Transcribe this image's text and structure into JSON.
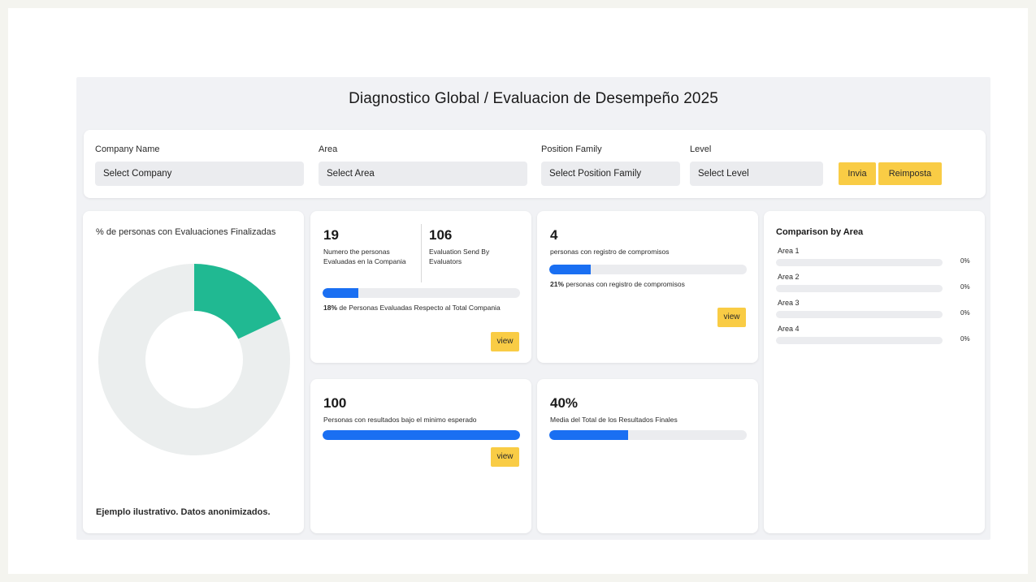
{
  "header": {
    "title": "Diagnostico Global / Evaluacion de Desempeño 2025"
  },
  "filters": {
    "company": {
      "label": "Company Name",
      "value": "Select Company"
    },
    "area": {
      "label": "Area",
      "value": "Select Area"
    },
    "position_family": {
      "label": "Position Family",
      "value": "Select Position Family"
    },
    "level": {
      "label": "Level",
      "value": "Select Level"
    },
    "submit_label": "Invia",
    "reset_label": "Reimposta",
    "accent_color": "#f9cc45"
  },
  "donut": {
    "title": "% de personas con Evaluaciones Finalizadas",
    "completed_fraction": 0.18,
    "completed_color": "#20b992",
    "remaining_color": "#ebeeee",
    "footer": "Ejemplo ilustrativo. Datos anonimizados."
  },
  "card_evaluated": {
    "count": "19",
    "count_label": "Numero the personas Evaluadas en la Compania",
    "sent": "106",
    "sent_label": "Evaluation Send By Evaluators",
    "progress": 0.18,
    "pct": "18%",
    "pct_text": " de Personas Evaluadas Respecto al Total Compania",
    "view_label": "view"
  },
  "card_commitments": {
    "count": "4",
    "count_label": "personas con registro de compromisos",
    "progress": 0.21,
    "pct": "21%",
    "pct_text": " personas con registro de compromisos",
    "view_label": "view"
  },
  "card_below": {
    "count": "100",
    "count_label": "Personas con resultados bajo el minimo esperado",
    "progress": 1.0,
    "view_label": "view"
  },
  "card_average": {
    "value": "40%",
    "label": "Media del Total de los Resultados Finales",
    "progress": 0.4
  },
  "comparison": {
    "title": "Comparison by Area",
    "areas": [
      {
        "label": "Area 1",
        "pct": "0%"
      },
      {
        "label": "Area 2",
        "pct": "0%"
      },
      {
        "label": "Area 3",
        "pct": "0%"
      },
      {
        "label": "Area 4",
        "pct": "0%"
      }
    ]
  },
  "colors": {
    "progress": "#1a6ff2",
    "background": "#f4f4ef"
  }
}
